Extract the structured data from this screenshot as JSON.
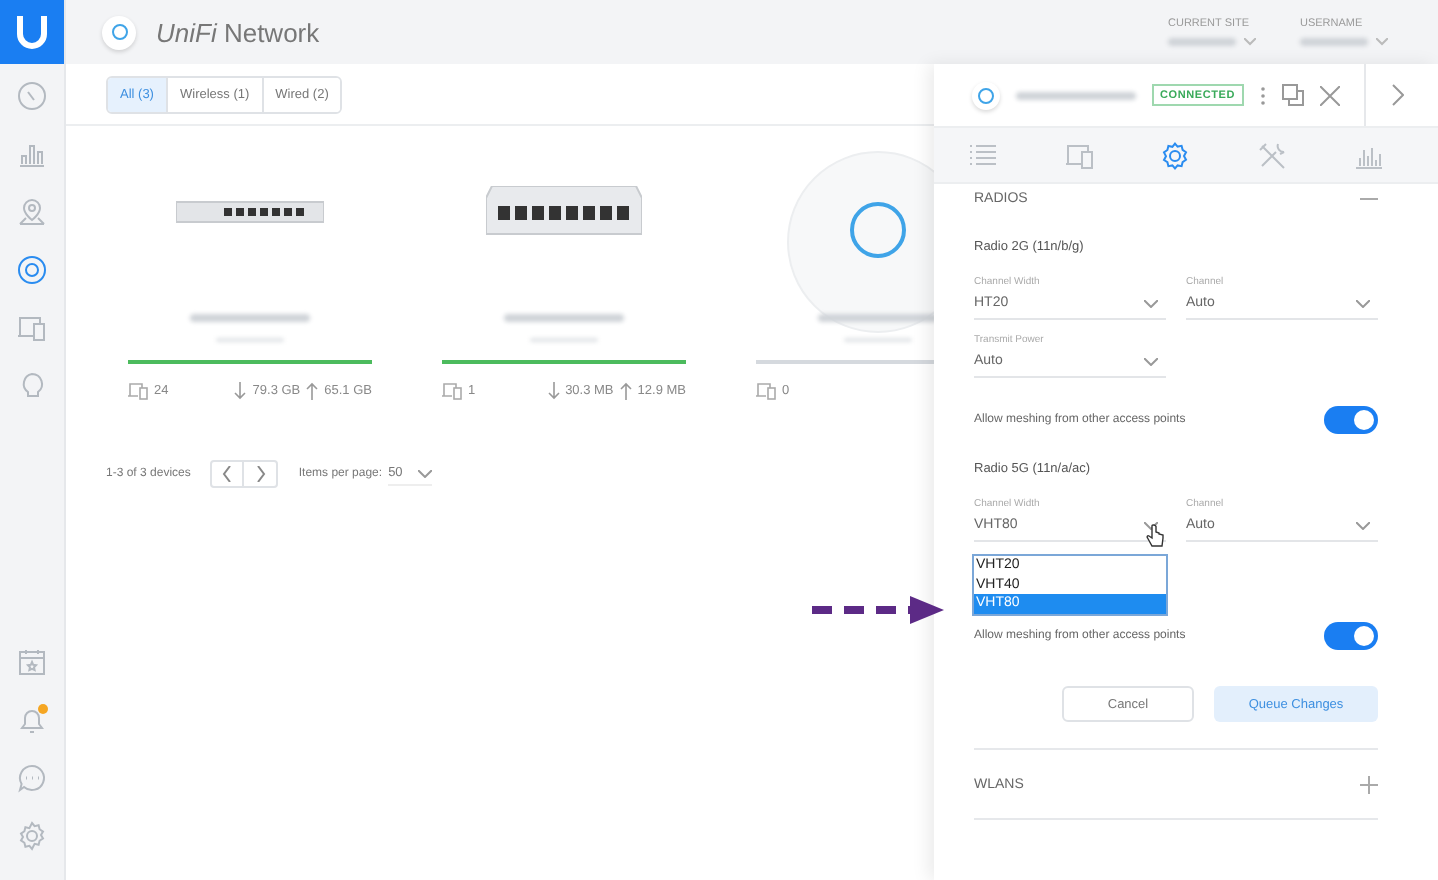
{
  "app": {
    "title": "*UniFi* Network"
  },
  "header": {
    "fields": [
      {
        "label": "CURRENT SITE"
      },
      {
        "label": "USERNAME"
      }
    ]
  },
  "sidebar": {
    "items": [
      {
        "kind": "dashboard",
        "selected": false
      },
      {
        "kind": "statistics",
        "selected": false
      },
      {
        "kind": "map",
        "selected": false
      },
      {
        "kind": "devices",
        "selected": true
      },
      {
        "kind": "clients",
        "selected": false
      },
      {
        "kind": "insights",
        "selected": false
      }
    ],
    "bottom_items": [
      {
        "kind": "events",
        "selected": false
      },
      {
        "kind": "alerts",
        "selected": false,
        "alert": true
      },
      {
        "kind": "chat",
        "selected": false
      },
      {
        "kind": "settings",
        "selected": false
      }
    ]
  },
  "filters": [
    {
      "label": "All (3)",
      "selected": true
    },
    {
      "label": "Wireless (1)",
      "selected": false
    },
    {
      "label": "Wired (2)",
      "selected": false
    }
  ],
  "devices": [
    {
      "kind": "switch-small",
      "clients": "24",
      "download": "79.3 GB",
      "upload": "65.1 GB",
      "color": "#4cbb5d"
    },
    {
      "kind": "switch-large",
      "clients": "1",
      "download": "30.3 MB",
      "upload": "12.9 MB",
      "color": "#4cbb5d"
    },
    {
      "kind": "access-point",
      "clients": "0",
      "color": "#d5d9de"
    }
  ],
  "pagination": {
    "range": "1-3 of 3 devices",
    "per_page_label": "Items per page:",
    "per_page": "50"
  },
  "panel": {
    "status": "CONNECTED",
    "tabs": [
      {
        "kind": "details",
        "selected": false
      },
      {
        "kind": "clients",
        "selected": false
      },
      {
        "kind": "config",
        "selected": true
      },
      {
        "kind": "tools",
        "selected": false
      },
      {
        "kind": "stats",
        "selected": false
      }
    ],
    "sections": [
      {
        "title": "RADIOS",
        "expanded": true
      },
      {
        "title": "WLANS",
        "expanded": false
      }
    ],
    "radios": [
      {
        "title": "Radio 2G (11n/b/g)",
        "fields": [
          {
            "label": "Channel Width",
            "value": "HT20"
          },
          {
            "label": "Channel",
            "value": "Auto"
          },
          {
            "label": "Transmit Power",
            "value": "Auto"
          }
        ],
        "mesh": {
          "label": "Allow meshing from other access points",
          "on": true
        }
      },
      {
        "title": "Radio 5G (11n/a/ac)",
        "fields": [
          {
            "label": "Channel Width",
            "value": "VHT80",
            "options": [
              {
                "label": "VHT20",
                "selected": false
              },
              {
                "label": "VHT40",
                "selected": false
              },
              {
                "label": "VHT80",
                "selected": true
              }
            ]
          },
          {
            "label": "Channel",
            "value": "Auto"
          }
        ],
        "mesh": {
          "label": "Allow meshing from other access points",
          "on": true
        }
      }
    ],
    "buttons": [
      {
        "label": "Cancel",
        "kind": "secondary"
      },
      {
        "label": "Queue Changes",
        "kind": "primary"
      }
    ]
  }
}
